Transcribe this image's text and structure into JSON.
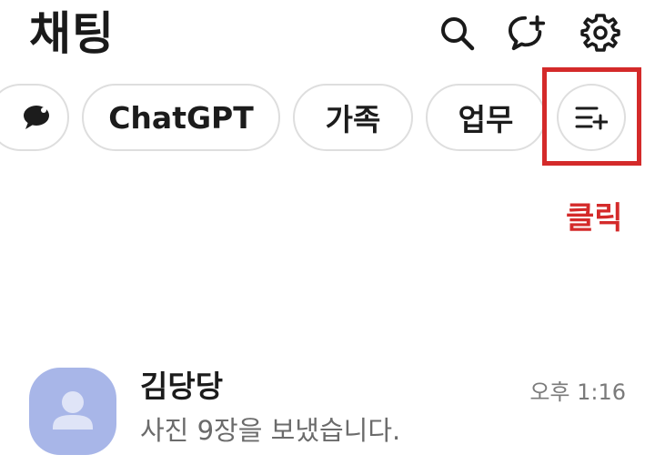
{
  "header": {
    "title": "채팅",
    "icons": [
      "search-icon",
      "new-chat-icon",
      "settings-icon"
    ]
  },
  "filters": {
    "chips": [
      "ChatGPT",
      "가족",
      "업무"
    ],
    "first_chip_icon": "speech-bubble-icon",
    "edit_icon": "list-add-icon"
  },
  "annotation": {
    "label": "클릭",
    "color": "#d42a2a"
  },
  "chat_list": [
    {
      "name": "김당당",
      "preview": "사진 9장을 보냈습니다.",
      "time": "오후 1:16",
      "avatar_color": "#a8b6e8"
    }
  ]
}
